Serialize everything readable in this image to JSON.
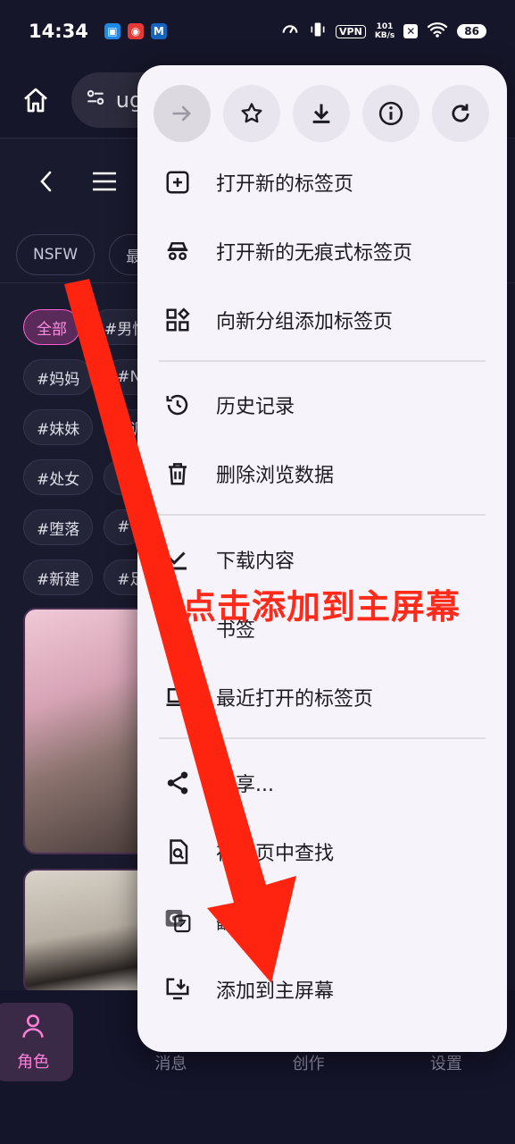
{
  "status": {
    "time": "14:34",
    "vpn": "VPN",
    "speed_top": "101",
    "speed_bottom": "KB/s",
    "battery": "86"
  },
  "address": {
    "url_partial": "ug"
  },
  "chips": [
    "NSFW",
    "最"
  ],
  "tags": [
    [
      "全部",
      "#男性"
    ],
    [
      "#妈妈",
      "#N"
    ],
    [
      "#妹妹",
      "#调"
    ],
    [
      "#处女",
      ""
    ],
    [
      "#堕落",
      "#"
    ],
    [
      "#新建",
      "#足"
    ]
  ],
  "nav": [
    {
      "label": "角色",
      "active": true
    },
    {
      "label": "消息",
      "active": false
    },
    {
      "label": "创作",
      "active": false
    },
    {
      "label": "设置",
      "active": false
    }
  ],
  "menu": {
    "items": [
      {
        "label": "打开新的标签页",
        "icon": "new-tab-icon"
      },
      {
        "label": "打开新的无痕式标签页",
        "icon": "incognito-icon"
      },
      {
        "label": "向新分组添加标签页",
        "icon": "tab-group-icon"
      },
      {
        "label": "历史记录",
        "icon": "history-icon"
      },
      {
        "label": "删除浏览数据",
        "icon": "trash-icon"
      },
      {
        "label": "下载内容",
        "icon": "download-check-icon"
      },
      {
        "label": "书签",
        "icon": "bookmark-icon"
      },
      {
        "label": "最近打开的标签页",
        "icon": "laptop-icon"
      },
      {
        "label": "分享...",
        "icon": "share-icon"
      },
      {
        "label": "在网页中查找",
        "icon": "find-in-page-icon"
      },
      {
        "label": "翻译...",
        "icon": "translate-icon"
      },
      {
        "label": "添加到主屏幕",
        "icon": "add-to-home-icon"
      }
    ]
  },
  "annotation": "点击添加到主屏幕",
  "colors": {
    "accent_pink": "#ff5fd0",
    "annotation_red": "#ff2a1a",
    "menu_bg": "#f6f3fa"
  }
}
